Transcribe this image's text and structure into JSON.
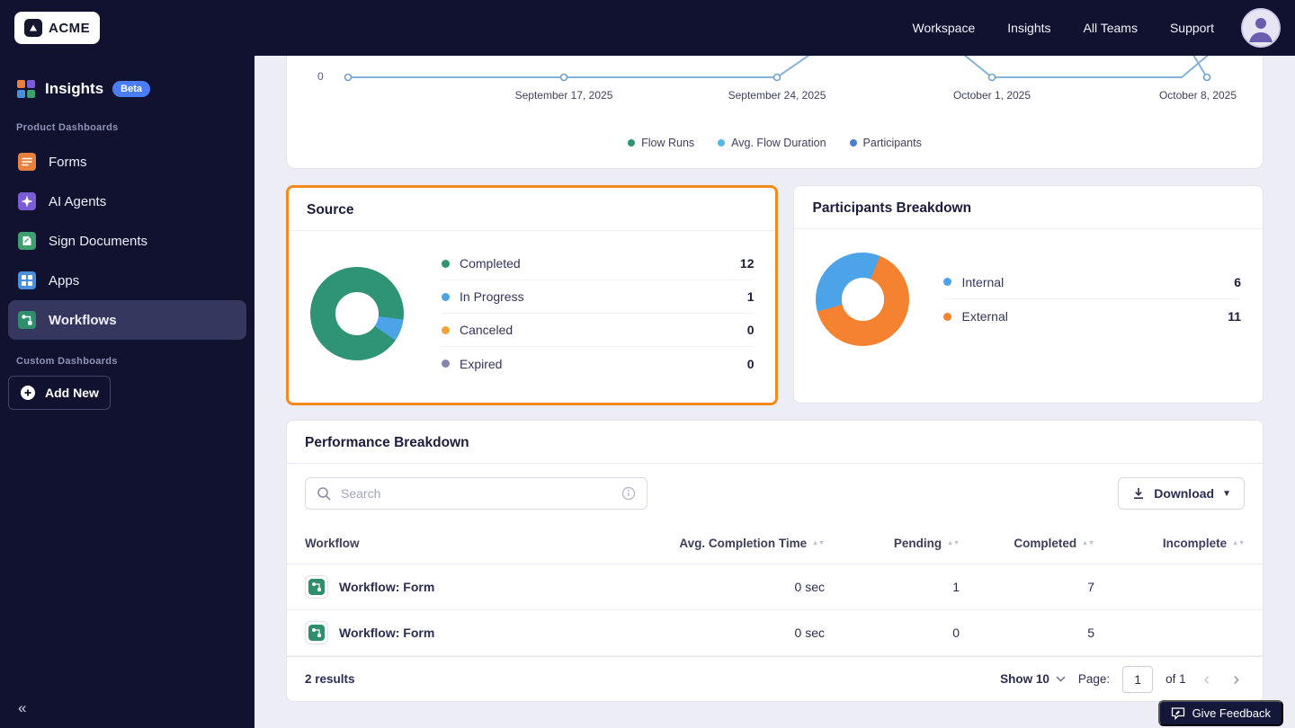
{
  "topnav": {
    "brand": "ACME",
    "links": [
      {
        "label": "Workspace"
      },
      {
        "label": "Insights"
      },
      {
        "label": "All Teams"
      },
      {
        "label": "Support"
      }
    ]
  },
  "sidebar": {
    "app_title": "Insights",
    "beta_badge": "Beta",
    "product_section_label": "Product Dashboards",
    "items": [
      {
        "label": "Forms"
      },
      {
        "label": "AI Agents"
      },
      {
        "label": "Sign Documents"
      },
      {
        "label": "Apps"
      },
      {
        "label": "Workflows"
      }
    ],
    "custom_section_label": "Custom Dashboards",
    "add_new_label": "Add New",
    "collapse_glyph": "«"
  },
  "trend_chart": {
    "y_tick": "0",
    "x_labels": [
      "September 17, 2025",
      "September 24, 2025",
      "October 1, 2025",
      "October 8, 2025"
    ],
    "line_color": "#85b2d9",
    "legend": [
      {
        "label": "Flow Runs",
        "color": "#2e9475"
      },
      {
        "label": "Avg. Flow Duration",
        "color": "#55b7e5"
      },
      {
        "label": "Participants",
        "color": "#4a7fd4"
      }
    ]
  },
  "source_card": {
    "title": "Source",
    "highlight_color": "#f28a1e",
    "donut": {
      "start_deg": 125,
      "segments": [
        {
          "color": "#2e9475",
          "value": 12
        },
        {
          "color": "#4da3e8",
          "value": 1
        },
        {
          "color": "#f0a53a",
          "value": 0
        },
        {
          "color": "#8585ad",
          "value": 0
        }
      ]
    },
    "legend": [
      {
        "label": "Completed",
        "value": "12",
        "color": "#2e9475"
      },
      {
        "label": "In Progress",
        "value": "1",
        "color": "#4da3e8"
      },
      {
        "label": "Canceled",
        "value": "0",
        "color": "#f0a53a"
      },
      {
        "label": "Expired",
        "value": "0",
        "color": "#8585ad"
      }
    ]
  },
  "participants_card": {
    "title": "Participants Breakdown",
    "donut": {
      "start_deg": 255,
      "segments": [
        {
          "color": "#4da3e8",
          "value": 6
        },
        {
          "color": "#f58230",
          "value": 11
        }
      ]
    },
    "legend": [
      {
        "label": "Internal",
        "value": "6",
        "color": "#4da3e8"
      },
      {
        "label": "External",
        "value": "11",
        "color": "#f58230"
      }
    ]
  },
  "performance_card": {
    "title": "Performance Breakdown",
    "search_placeholder": "Search",
    "download_label": "Download",
    "columns": [
      "Workflow",
      "Avg. Completion Time",
      "Pending",
      "Completed",
      "Incomplete"
    ],
    "rows": [
      {
        "name": "Workflow: Form",
        "avg_completion": "0 sec",
        "pending": "1",
        "completed": "7",
        "incomplete": ""
      },
      {
        "name": "Workflow: Form",
        "avg_completion": "0 sec",
        "pending": "0",
        "completed": "5",
        "incomplete": ""
      }
    ],
    "footer": {
      "results": "2 results",
      "show_label": "Show 10",
      "page_label": "Page:",
      "page_value": "1",
      "of_label": "of 1"
    }
  },
  "feedback_button": {
    "label": "Give Feedback"
  },
  "chart_data": [
    {
      "type": "line",
      "title": "Flow activity over time (cropped at top of viewport)",
      "x": [
        "September 17, 2025",
        "September 24, 2025",
        "October 1, 2025",
        "October 8, 2025"
      ],
      "series": [
        {
          "name": "Flow Runs"
        },
        {
          "name": "Avg. Flow Duration"
        },
        {
          "name": "Participants"
        }
      ],
      "visible_y_ticks": [
        0
      ],
      "legend_position": "bottom"
    },
    {
      "type": "pie",
      "title": "Source",
      "categories": [
        "Completed",
        "In Progress",
        "Canceled",
        "Expired"
      ],
      "values": [
        12,
        1,
        0,
        0
      ]
    },
    {
      "type": "pie",
      "title": "Participants Breakdown",
      "categories": [
        "Internal",
        "External"
      ],
      "values": [
        6,
        11
      ]
    }
  ]
}
